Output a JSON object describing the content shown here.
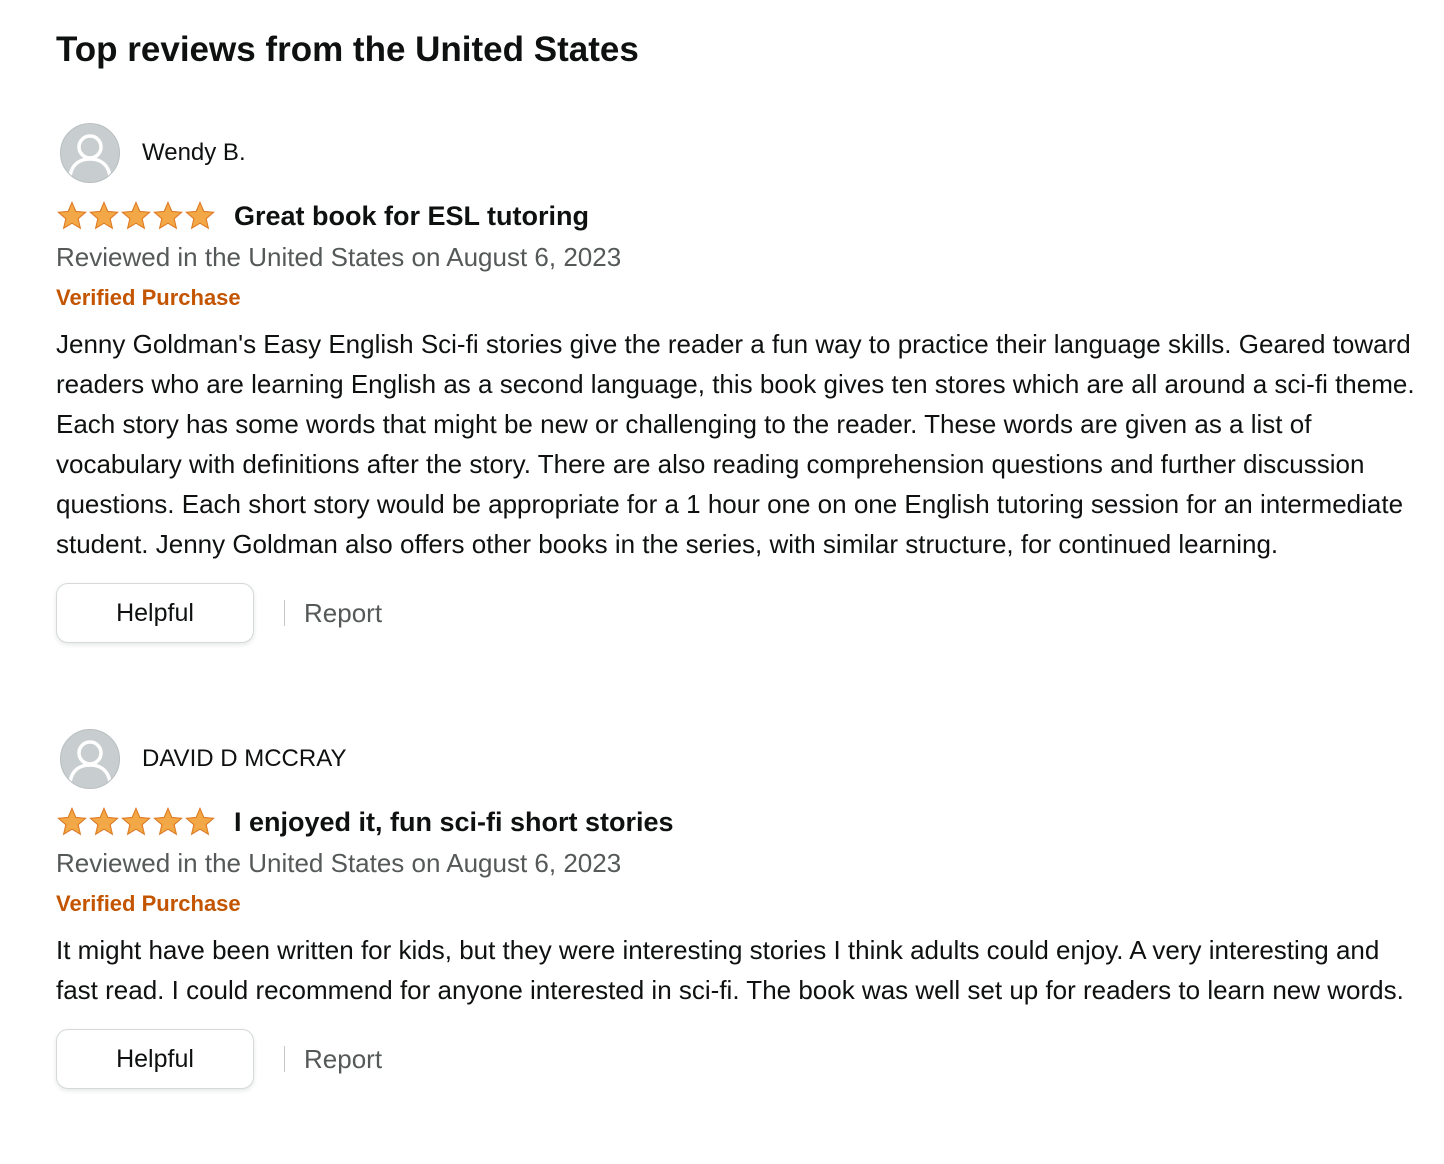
{
  "section": {
    "title": "Top reviews from the United States"
  },
  "colors": {
    "star": "#f3a847",
    "verified": "#c45500",
    "muted_text": "#565959",
    "text": "#0f1111"
  },
  "reviews": [
    {
      "author": "Wendy B.",
      "rating": 5,
      "rating_max": 5,
      "title": "Great book for ESL tutoring",
      "date": "Reviewed in the United States on August 6, 2023",
      "verified": "Verified Purchase",
      "body": "Jenny Goldman's Easy English Sci-fi stories give the reader a fun way to practice their language skills. Geared toward readers who are learning English as a second language, this book gives ten stores which are all around a sci-fi theme. Each story has some words that might be new or challenging to the reader. These words are given as a list of vocabulary with definitions after the story. There are also reading comprehension questions and further discussion questions. Each short story would be appropriate for a 1 hour one on one English tutoring session for an intermediate student. Jenny Goldman also offers other books in the series, with similar structure, for continued learning.",
      "helpful_label": "Helpful",
      "report_label": "Report"
    },
    {
      "author": "DAVID D MCCRAY",
      "rating": 5,
      "rating_max": 5,
      "title": "I enjoyed it, fun sci-fi short stories",
      "date": "Reviewed in the United States on August 6, 2023",
      "verified": "Verified Purchase",
      "body": "It might have been written for kids, but they were interesting stories I think adults could enjoy. A very interesting and fast read. I could recommend for anyone interested in sci-fi. The book was well set up for readers to learn new words.",
      "helpful_label": "Helpful",
      "report_label": "Report"
    }
  ]
}
